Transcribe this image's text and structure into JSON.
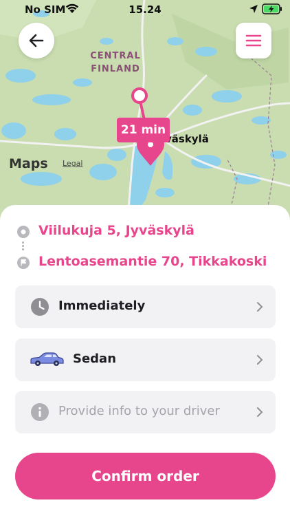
{
  "status_bar": {
    "carrier": "No SIM",
    "time": "15.24",
    "wifi_icon": "wifi-icon",
    "location_icon": "location-arrow-icon",
    "battery_icon": "battery-charging-icon"
  },
  "map": {
    "region_label": "CENTRAL FINLAND",
    "city_label": "väskylä",
    "eta_badge": "21 min",
    "attribution": "Maps",
    "legal": "Legal",
    "colors": {
      "land": "#c9ddb0",
      "water": "#8fd0ea",
      "route": "#e8468c"
    }
  },
  "header": {
    "back_icon": "arrow-left-icon",
    "menu_icon": "hamburger-menu-icon"
  },
  "trip": {
    "pickup": "Viilukuja 5, Jyväskylä",
    "destination": "Lentoasemantie 70, Tikkakoski"
  },
  "options": [
    {
      "label": "Immediately",
      "icon": "clock-icon",
      "placeholder": false
    },
    {
      "label": "Sedan",
      "icon": "sedan-car-icon",
      "placeholder": false
    },
    {
      "label": "Provide info to your driver",
      "icon": "info-icon",
      "placeholder": true
    }
  ],
  "confirm_label": "Confirm order",
  "colors": {
    "accent": "#e8468c",
    "option_bg": "#f2f2f5",
    "icon_gray": "#8e8e93"
  }
}
